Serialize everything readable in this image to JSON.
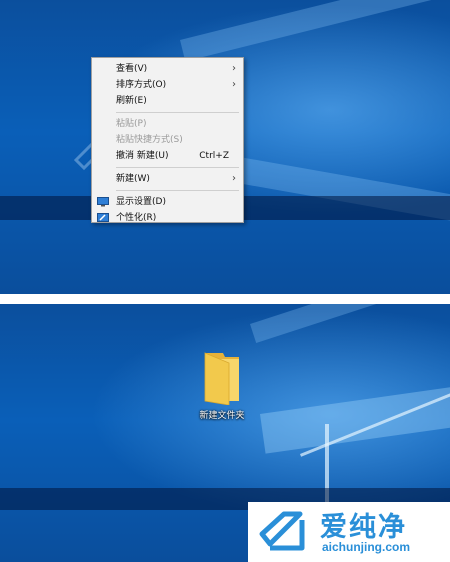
{
  "context_menu": {
    "items": [
      {
        "label": "查看(V)",
        "has_submenu": true,
        "enabled": true
      },
      {
        "label": "排序方式(O)",
        "has_submenu": true,
        "enabled": true
      },
      {
        "label": "刷新(E)",
        "has_submenu": false,
        "enabled": true
      },
      {
        "label": "粘贴(P)",
        "has_submenu": false,
        "enabled": false
      },
      {
        "label": "粘贴快捷方式(S)",
        "has_submenu": false,
        "enabled": false
      },
      {
        "label": "撤消 新建(U)",
        "shortcut": "Ctrl+Z",
        "has_submenu": false,
        "enabled": true
      },
      {
        "label": "新建(W)",
        "has_submenu": true,
        "enabled": true
      },
      {
        "label": "显示设置(D)",
        "icon": "display-icon",
        "has_submenu": false,
        "enabled": true
      },
      {
        "label": "个性化(R)",
        "icon": "personalize-icon",
        "has_submenu": false,
        "enabled": true
      }
    ],
    "submenu_arrow": "›"
  },
  "desktop": {
    "folder_label": "新建文件夹",
    "folder_color": "#f2c94c"
  },
  "watermark": {
    "brand_cn": "爱纯净",
    "brand_en": "aichunjing.com",
    "color": "#2a8fd8"
  },
  "colors": {
    "desktop_blue": "#0a5fb8",
    "menu_bg": "#f2f2f2"
  }
}
